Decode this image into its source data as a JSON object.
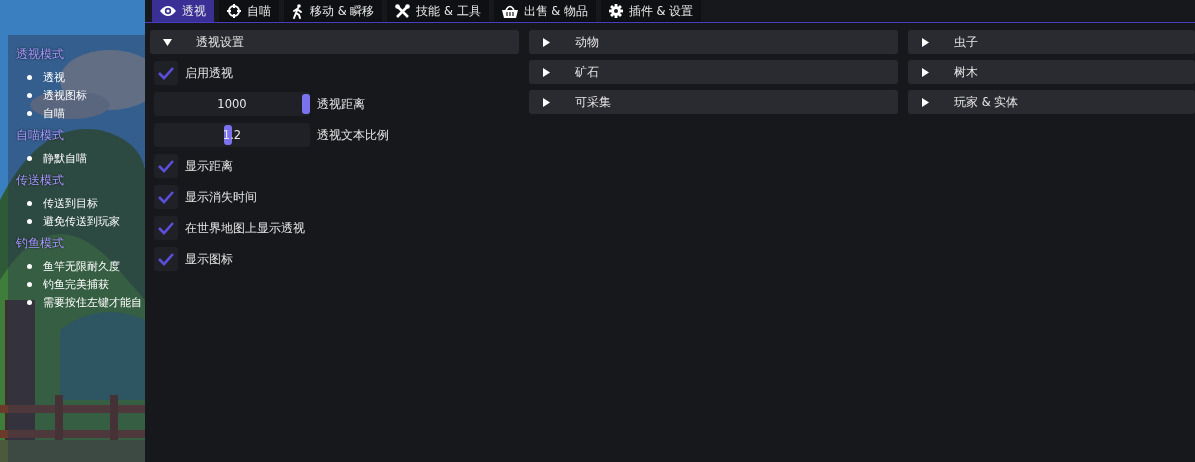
{
  "sidebar": {
    "groups": [
      {
        "heading": "透视模式",
        "items": [
          "透视",
          "透视图标",
          "自喵"
        ]
      },
      {
        "heading": "自喵模式",
        "items": [
          "静默自喵"
        ]
      },
      {
        "heading": "传送模式",
        "items": [
          "传送到目标",
          "避免传送到玩家"
        ]
      },
      {
        "heading": "钓鱼模式",
        "items": [
          "鱼竿无限耐久度",
          "钓鱼完美捕获",
          "需要按住左键才能自"
        ]
      }
    ]
  },
  "tabs": [
    {
      "label": "透视",
      "selected": true
    },
    {
      "label": "自喵",
      "selected": false
    },
    {
      "label": "移动 & 瞬移",
      "selected": false
    },
    {
      "label": "技能 & 工具",
      "selected": false
    },
    {
      "label": "出售 & 物品",
      "selected": false
    },
    {
      "label": "插件 & 设置",
      "selected": false
    }
  ],
  "columns": [
    [
      {
        "title": "透视设置",
        "expanded": true,
        "items": [
          {
            "kind": "checkbox",
            "label": "启用透视",
            "checked": true
          },
          {
            "kind": "slider",
            "label": "透视距离",
            "reading": "1000",
            "level": 1
          },
          {
            "kind": "slider",
            "label": "透视文本比例",
            "reading": "1.2",
            "level": 0.47
          },
          {
            "kind": "checkbox",
            "label": "显示距离",
            "checked": true
          },
          {
            "kind": "checkbox",
            "label": "显示消失时间",
            "checked": true
          },
          {
            "kind": "checkbox",
            "label": "在世界地图上显示透视",
            "checked": true
          },
          {
            "kind": "checkbox",
            "label": "显示图标",
            "checked": true
          }
        ]
      }
    ],
    [
      {
        "title": "动物",
        "expanded": false
      },
      {
        "title": "矿石",
        "expanded": false
      },
      {
        "title": "可采集",
        "expanded": false
      }
    ],
    [
      {
        "title": "虫子",
        "expanded": false
      },
      {
        "title": "树木",
        "expanded": false
      },
      {
        "title": "玩家 & 实体",
        "expanded": false
      }
    ]
  ]
}
